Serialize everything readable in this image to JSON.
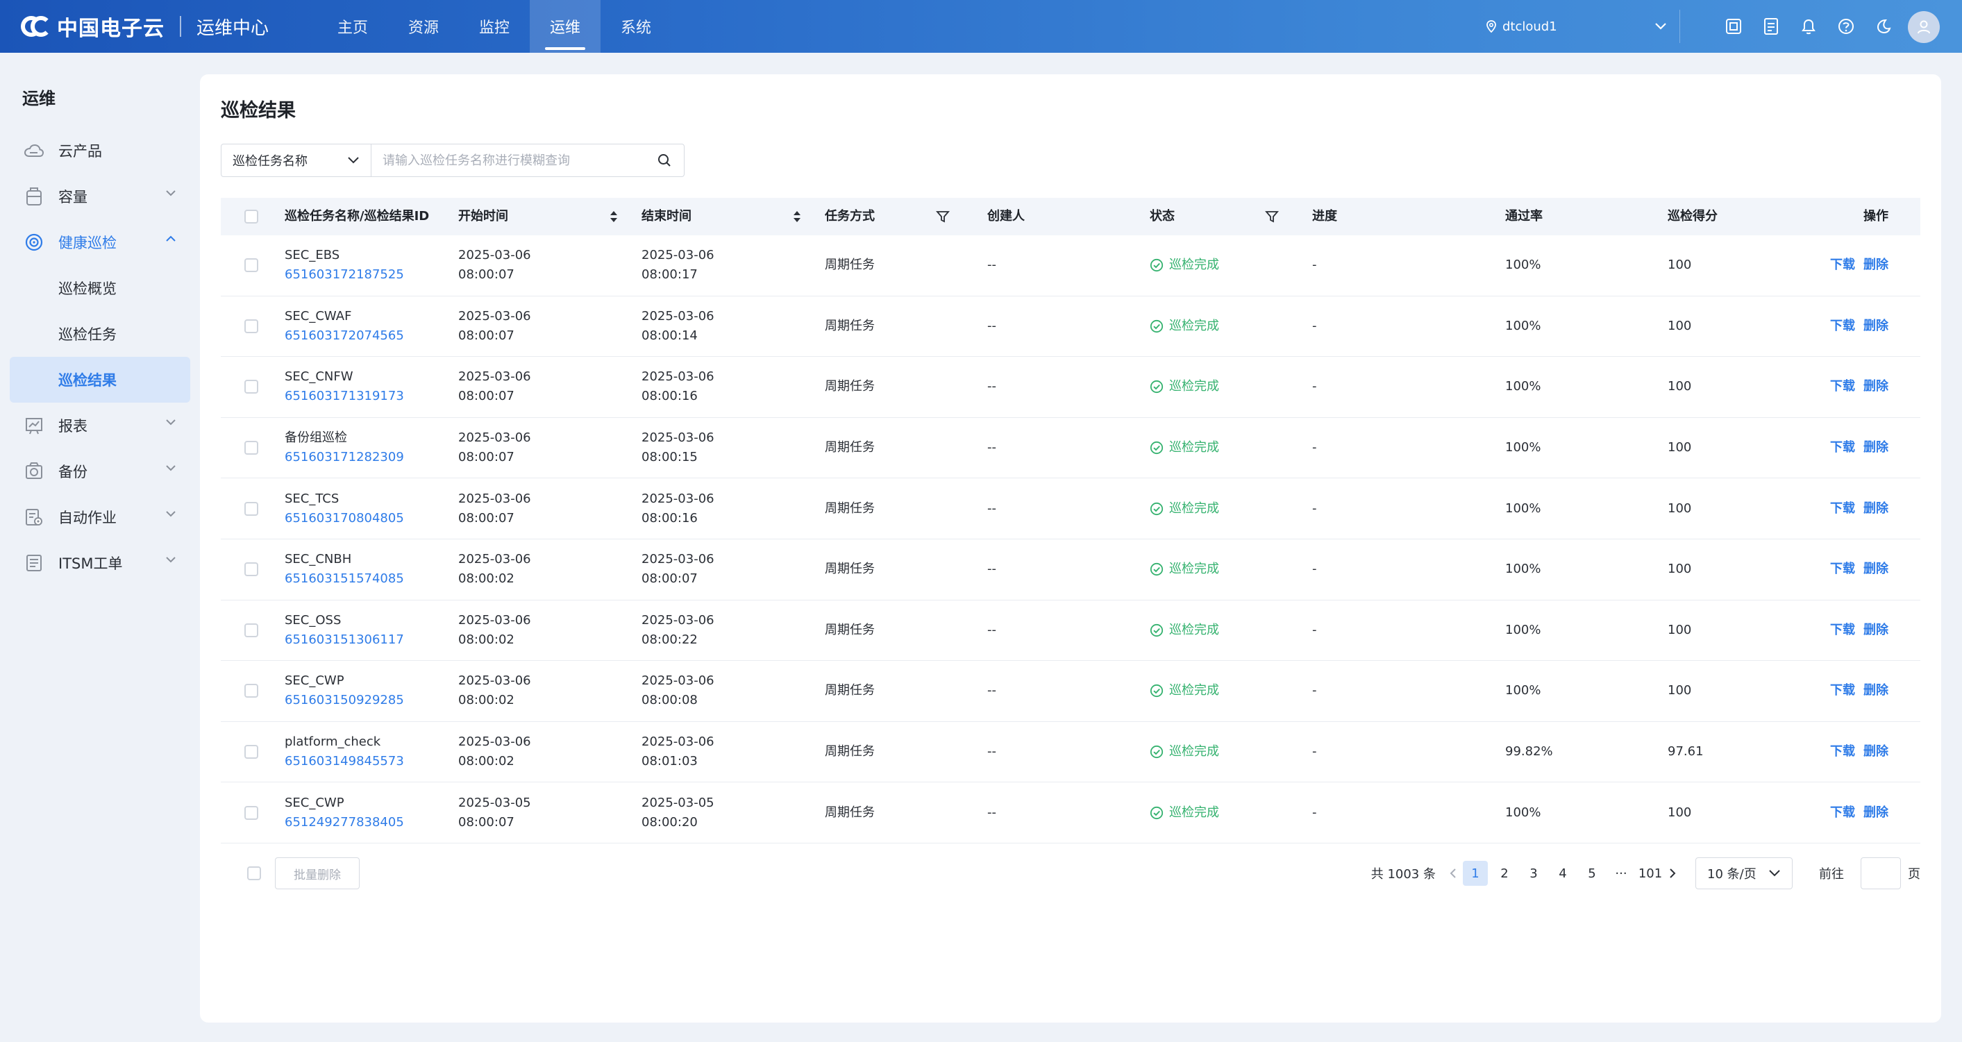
{
  "header": {
    "brand": "中国电子云",
    "subtitle": "运维中心",
    "nav": [
      {
        "label": "主页",
        "active": false
      },
      {
        "label": "资源",
        "active": false
      },
      {
        "label": "监控",
        "active": false
      },
      {
        "label": "运维",
        "active": true
      },
      {
        "label": "系统",
        "active": false
      }
    ],
    "region": "dtcloud1",
    "icons": [
      "screen-icon",
      "document-icon",
      "bell-icon",
      "help-icon",
      "moon-icon"
    ],
    "accent": "#2f7ce8"
  },
  "sidebar": {
    "title": "运维",
    "items": [
      {
        "label": "云产品",
        "icon": "cloud-icon"
      },
      {
        "label": "容量",
        "icon": "capacity-icon"
      },
      {
        "label": "健康巡检",
        "icon": "target-icon"
      },
      {
        "label": "报表",
        "icon": "report-icon"
      },
      {
        "label": "备份",
        "icon": "backup-icon"
      },
      {
        "label": "自动作业",
        "icon": "auto-job-icon"
      },
      {
        "label": "ITSM工单",
        "icon": "ticket-icon"
      }
    ],
    "sub_items": [
      {
        "label": "巡检概览"
      },
      {
        "label": "巡检任务"
      },
      {
        "label": "巡检结果"
      }
    ]
  },
  "main": {
    "title": "巡检结果",
    "search": {
      "field": "巡检任务名称",
      "placeholder": "请输入巡检任务名称进行模糊查询"
    },
    "columns": {
      "name": "巡检任务名称/巡检结果ID",
      "start": "开始时间",
      "end": "结束时间",
      "mode": "任务方式",
      "creator": "创建人",
      "status": "状态",
      "progress": "进度",
      "pass_rate": "通过率",
      "score": "巡检得分",
      "ops": "操作"
    },
    "rows": [
      {
        "name": "SEC_EBS",
        "id": "651603172187525",
        "start_date": "2025-03-06",
        "start_time": "08:00:07",
        "end_date": "2025-03-06",
        "end_time": "08:00:17",
        "mode": "周期任务",
        "creator": "--",
        "status": "巡检完成",
        "progress": "-",
        "pass_rate": "100%",
        "score": "100"
      },
      {
        "name": "SEC_CWAF",
        "id": "651603172074565",
        "start_date": "2025-03-06",
        "start_time": "08:00:07",
        "end_date": "2025-03-06",
        "end_time": "08:00:14",
        "mode": "周期任务",
        "creator": "--",
        "status": "巡检完成",
        "progress": "-",
        "pass_rate": "100%",
        "score": "100"
      },
      {
        "name": "SEC_CNFW",
        "id": "651603171319173",
        "start_date": "2025-03-06",
        "start_time": "08:00:07",
        "end_date": "2025-03-06",
        "end_time": "08:00:16",
        "mode": "周期任务",
        "creator": "--",
        "status": "巡检完成",
        "progress": "-",
        "pass_rate": "100%",
        "score": "100"
      },
      {
        "name": "备份组巡检",
        "id": "651603171282309",
        "start_date": "2025-03-06",
        "start_time": "08:00:07",
        "end_date": "2025-03-06",
        "end_time": "08:00:15",
        "mode": "周期任务",
        "creator": "--",
        "status": "巡检完成",
        "progress": "-",
        "pass_rate": "100%",
        "score": "100"
      },
      {
        "name": "SEC_TCS",
        "id": "651603170804805",
        "start_date": "2025-03-06",
        "start_time": "08:00:07",
        "end_date": "2025-03-06",
        "end_time": "08:00:16",
        "mode": "周期任务",
        "creator": "--",
        "status": "巡检完成",
        "progress": "-",
        "pass_rate": "100%",
        "score": "100"
      },
      {
        "name": "SEC_CNBH",
        "id": "651603151574085",
        "start_date": "2025-03-06",
        "start_time": "08:00:02",
        "end_date": "2025-03-06",
        "end_time": "08:00:07",
        "mode": "周期任务",
        "creator": "--",
        "status": "巡检完成",
        "progress": "-",
        "pass_rate": "100%",
        "score": "100"
      },
      {
        "name": "SEC_OSS",
        "id": "651603151306117",
        "start_date": "2025-03-06",
        "start_time": "08:00:02",
        "end_date": "2025-03-06",
        "end_time": "08:00:22",
        "mode": "周期任务",
        "creator": "--",
        "status": "巡检完成",
        "progress": "-",
        "pass_rate": "100%",
        "score": "100"
      },
      {
        "name": "SEC_CWP",
        "id": "651603150929285",
        "start_date": "2025-03-06",
        "start_time": "08:00:02",
        "end_date": "2025-03-06",
        "end_time": "08:00:08",
        "mode": "周期任务",
        "creator": "--",
        "status": "巡检完成",
        "progress": "-",
        "pass_rate": "100%",
        "score": "100"
      },
      {
        "name": "platform_check",
        "id": "651603149845573",
        "start_date": "2025-03-06",
        "start_time": "08:00:02",
        "end_date": "2025-03-06",
        "end_time": "08:01:03",
        "mode": "周期任务",
        "creator": "--",
        "status": "巡检完成",
        "progress": "-",
        "pass_rate": "99.82%",
        "score": "97.61"
      },
      {
        "name": "SEC_CWP",
        "id": "651249277838405",
        "start_date": "2025-03-05",
        "start_time": "08:00:07",
        "end_date": "2025-03-05",
        "end_time": "08:00:20",
        "mode": "周期任务",
        "creator": "--",
        "status": "巡检完成",
        "progress": "-",
        "pass_rate": "100%",
        "score": "100"
      }
    ],
    "row_actions": {
      "download": "下载",
      "delete": "删除"
    },
    "status_color": "#35b26f"
  },
  "footer": {
    "batch_delete": "批量删除",
    "total": "共 1003 条",
    "pages": [
      "1",
      "2",
      "3",
      "4",
      "5"
    ],
    "active_page": "1",
    "ellipsis": "···",
    "last_page": "101",
    "page_size": "10 条/页",
    "goto_prefix": "前往",
    "goto_suffix": "页"
  }
}
